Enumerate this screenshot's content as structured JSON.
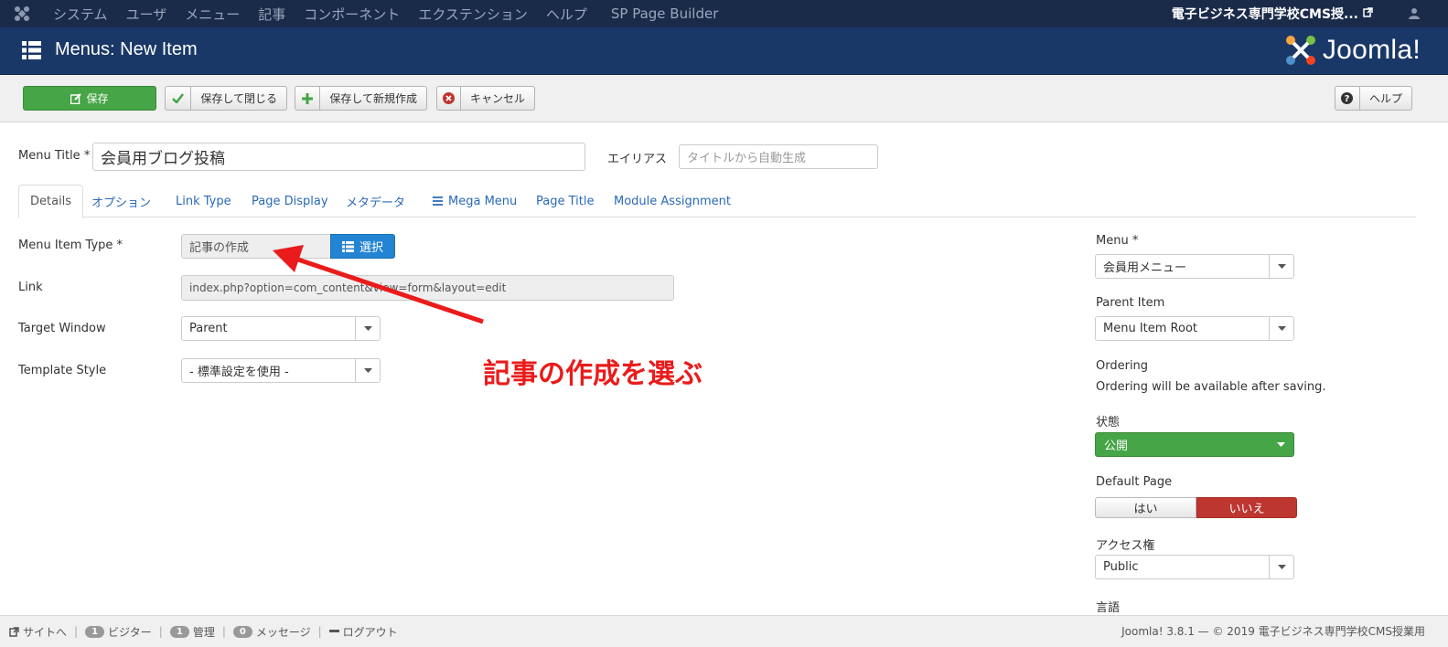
{
  "topnav": {
    "items": [
      "システム",
      "ユーザ",
      "メニュー",
      "記事",
      "コンポーネント",
      "エクステンション",
      "ヘルプ",
      "SP Page Builder"
    ],
    "site_link": "電子ビジネス専門学校CMS授..."
  },
  "header": {
    "title": "Menus: New Item",
    "brand": "Joomla!"
  },
  "toolbar": {
    "save": "保存",
    "save_close": "保存して閉じる",
    "save_new": "保存して新規作成",
    "cancel": "キャンセル",
    "help": "ヘルプ"
  },
  "form": {
    "menu_title_label": "Menu Title *",
    "menu_title_value": "会員用ブログ投稿",
    "alias_label": "エイリアス",
    "alias_placeholder": "タイトルから自動生成",
    "tabs": [
      "Details",
      "オプション",
      "Link Type",
      "Page Display",
      "メタデータ",
      "Mega Menu",
      "Page Title",
      "Module Assignment"
    ],
    "item_type_label": "Menu Item Type *",
    "item_type_value": "記事の作成",
    "select_button": "選択",
    "link_label": "Link",
    "link_value": "index.php?option=com_content&view=form&layout=edit",
    "target_label": "Target Window",
    "target_value": "Parent",
    "template_label": "Template Style",
    "template_value": "- 標準設定を使用 -"
  },
  "annotation": "記事の作成を選ぶ",
  "sidebar": {
    "menu_label": "Menu *",
    "menu_value": "会員用メニュー",
    "parent_label": "Parent Item",
    "parent_value": "Menu Item Root",
    "ordering_label": "Ordering",
    "ordering_note": "Ordering will be available after saving.",
    "status_label": "状態",
    "status_value": "公開",
    "default_label": "Default Page",
    "default_yes": "はい",
    "default_no": "いいえ",
    "access_label": "アクセス権",
    "access_value": "Public",
    "language_label": "言語"
  },
  "footer": {
    "site": "サイトへ",
    "visitors_count": "1",
    "visitors": "ビジター",
    "admins_count": "1",
    "admins": "管理",
    "messages_count": "0",
    "messages": "メッセージ",
    "logout": "ログアウト",
    "copyright": "Joomla! 3.8.1 — © 2019 電子ビジネス専門学校CMS授業用"
  },
  "colors": {
    "nav_bg": "#1a2b4a",
    "header_bg": "#1a3867",
    "save_green": "#46a546",
    "select_blue": "#2384d3",
    "no_red": "#bd362f",
    "annotation_red": "#ea1b1b"
  }
}
